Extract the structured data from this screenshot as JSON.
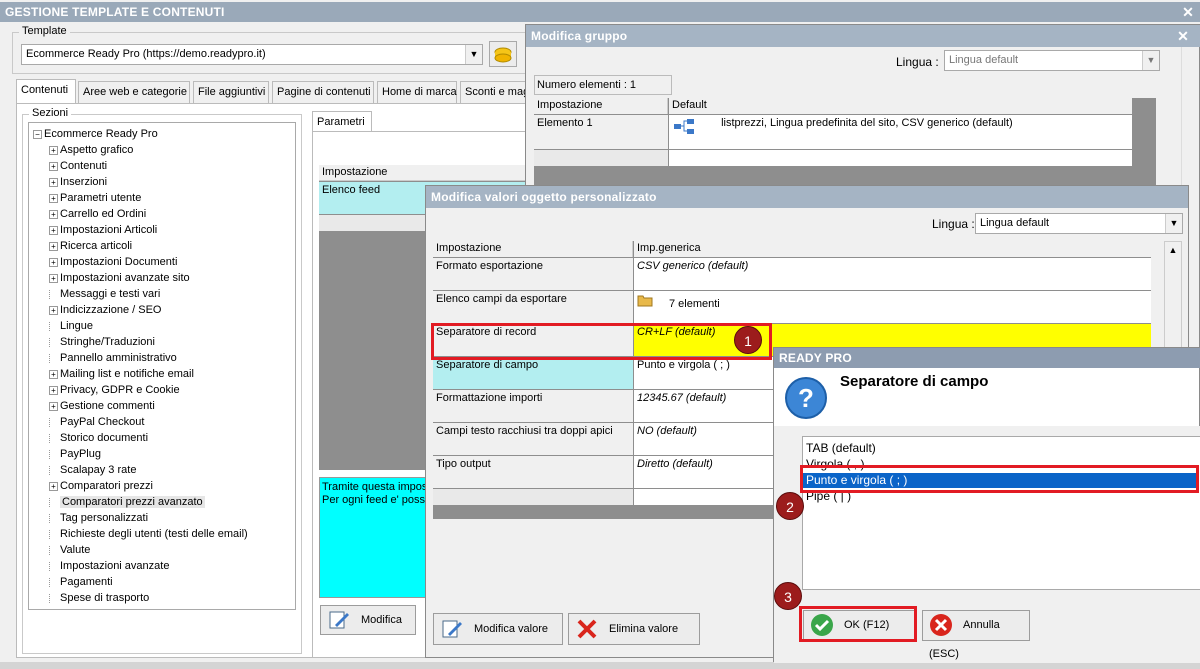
{
  "main": {
    "title": "GESTIONE TEMPLATE E CONTENUTI",
    "template_label": "Template",
    "template_value": "Ecommerce Ready Pro (https://demo.readypro.it)",
    "tabs": [
      "Contenuti",
      "Aree web e categorie",
      "File aggiuntivi",
      "Pagine di contenuti",
      "Home di marca",
      "Sconti e mag"
    ],
    "sections_label": "Sezioni",
    "tree_root": "Ecommerce Ready Pro",
    "tree_items": [
      {
        "label": "Aspetto grafico",
        "exp": true
      },
      {
        "label": "Contenuti",
        "exp": true
      },
      {
        "label": "Inserzioni",
        "exp": true
      },
      {
        "label": "Parametri utente",
        "exp": true
      },
      {
        "label": "Carrello ed Ordini",
        "exp": true
      },
      {
        "label": "Impostazioni Articoli",
        "exp": true
      },
      {
        "label": "Ricerca articoli",
        "exp": true
      },
      {
        "label": "Impostazioni Documenti",
        "exp": true
      },
      {
        "label": "Impostazioni avanzate sito",
        "exp": true
      },
      {
        "label": "Messaggi e testi vari",
        "exp": false
      },
      {
        "label": "Indicizzazione / SEO",
        "exp": true
      },
      {
        "label": "Lingue",
        "exp": false
      },
      {
        "label": "Stringhe/Traduzioni",
        "exp": false
      },
      {
        "label": "Pannello amministrativo",
        "exp": false
      },
      {
        "label": "Mailing list e notifiche email",
        "exp": true
      },
      {
        "label": "Privacy, GDPR e Cookie",
        "exp": true
      },
      {
        "label": "Gestione commenti",
        "exp": true
      },
      {
        "label": "PayPal Checkout",
        "exp": false
      },
      {
        "label": "Storico documenti",
        "exp": false
      },
      {
        "label": "PayPlug",
        "exp": false
      },
      {
        "label": "Scalapay 3 rate",
        "exp": false
      },
      {
        "label": "Comparatori prezzi",
        "exp": true
      },
      {
        "label": "Comparatori prezzi avanzato",
        "exp": false,
        "selected": true
      },
      {
        "label": "Tag personalizzati",
        "exp": false
      },
      {
        "label": "Richieste degli utenti (testi delle email)",
        "exp": false
      },
      {
        "label": "Valute",
        "exp": false
      },
      {
        "label": "Impostazioni avanzate",
        "exp": false
      },
      {
        "label": "Pagamenti",
        "exp": false
      },
      {
        "label": "Spese di trasporto",
        "exp": false
      }
    ],
    "params_tab": "Parametri",
    "params_header": "Impostazione",
    "params_row": "Elenco feed",
    "desc_line1": "Tramite questa impos",
    "desc_line2": "Per ogni feed e' possi",
    "modifica_btn": "Modifica"
  },
  "group_win": {
    "title": "Modifica gruppo",
    "lang_label": "Lingua :",
    "lang_value": "Lingua default",
    "count_label": "Numero elementi : 1",
    "col1": "Impostazione",
    "col2": "Default",
    "row_label": "Elemento 1",
    "row_value": "listprezzi, Lingua predefinita del sito, CSV generico (default)"
  },
  "values_win": {
    "title": "Modifica valori oggetto personalizzato",
    "lang_label": "Lingua :",
    "lang_value": "Lingua default",
    "col1": "Impostazione",
    "col2": "Imp.generica",
    "rows": [
      {
        "label": "Formato esportazione",
        "value": "CSV generico (default)",
        "italic": true
      },
      {
        "label": "Elenco campi da esportare",
        "value": "7 elementi",
        "italic": false,
        "icon": true
      },
      {
        "label": "Separatore di record",
        "value": "CR+LF (default)",
        "italic": true,
        "highlight": "yellow"
      },
      {
        "label": "Separatore di campo",
        "value": "Punto e virgola ( ; )",
        "italic": false,
        "highlight": "cyan"
      },
      {
        "label": "Formattazione importi",
        "value": "12345.67 (default)",
        "italic": true
      },
      {
        "label": "Campi testo racchiusi tra doppi apici",
        "value": "NO (default)",
        "italic": true
      },
      {
        "label": "Tipo output",
        "value": "Diretto (default)",
        "italic": true
      }
    ],
    "modifica_valore": "Modifica valore",
    "elimina_valore": "Elimina valore"
  },
  "dialog": {
    "title": "READY PRO",
    "heading": "Separatore di campo",
    "options": [
      "TAB (default)",
      "Virgola ( , )",
      "Punto e virgola ( ; )",
      "Pipe ( | )"
    ],
    "selected_index": 2,
    "ok": "OK (F12)",
    "cancel": "Annulla (ESC)"
  },
  "badges": [
    "1",
    "2",
    "3"
  ],
  "colors": {
    "titlebar": "#9aa9b9",
    "highlight_yellow": "#ffff00",
    "highlight_cyan": "#b3eef0",
    "selection": "#0a64c8",
    "badge": "#9c1c1c",
    "callout": "#e21b23"
  }
}
